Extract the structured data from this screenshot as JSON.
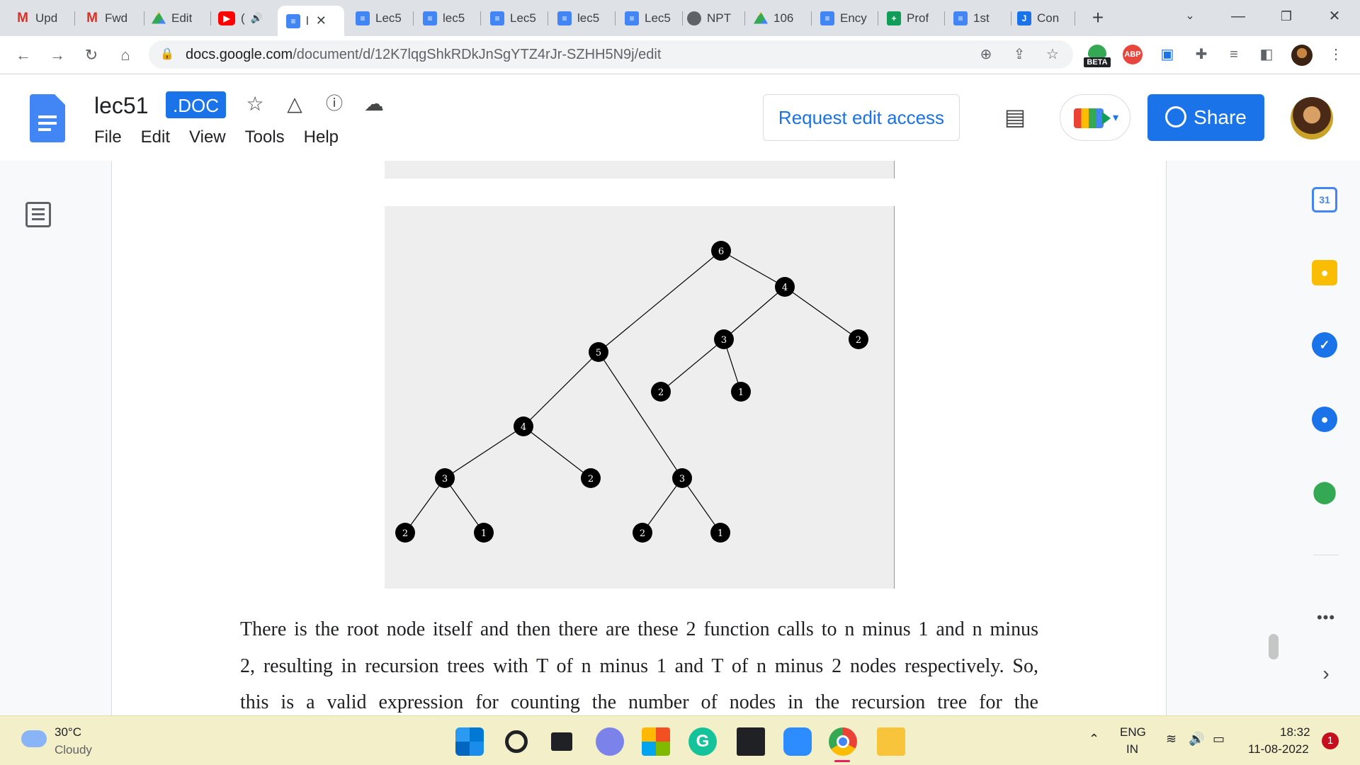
{
  "browser": {
    "tabs": [
      {
        "label": "Upd",
        "icon": "gmail-icon"
      },
      {
        "label": "Fwd",
        "icon": "gmail-icon"
      },
      {
        "label": "Edit",
        "icon": "drive-icon"
      },
      {
        "label": "(",
        "icon": "youtube-icon"
      },
      {
        "label": "l",
        "icon": "docs-icon",
        "active": true
      },
      {
        "label": "Lec5",
        "icon": "docs-icon"
      },
      {
        "label": "lec5",
        "icon": "docs-icon"
      },
      {
        "label": "Lec5",
        "icon": "docs-icon"
      },
      {
        "label": "lec5",
        "icon": "docs-icon"
      },
      {
        "label": "Lec5",
        "icon": "docs-icon"
      },
      {
        "label": "NPT",
        "icon": "globe-icon"
      },
      {
        "label": "106",
        "icon": "drive-icon"
      },
      {
        "label": "Ency",
        "icon": "docs-icon"
      },
      {
        "label": "Prof",
        "icon": "sheets-icon"
      },
      {
        "label": "1st",
        "icon": "docs-icon"
      },
      {
        "label": "Con",
        "icon": "jamboard-icon"
      }
    ],
    "url_host": "docs.google.com",
    "url_path": "/document/d/12K7lqgShkRDkJnSgYTZ4rJr-SZHH5N9j/edit",
    "beta_label": "BETA",
    "abp_label": "ABP"
  },
  "docs": {
    "title": "lec51",
    "badge": ".DOC",
    "menu": [
      "File",
      "Edit",
      "View",
      "Tools",
      "Help"
    ],
    "request_edit_label": "Request edit access",
    "share_label": "Share",
    "calendar_day": "31"
  },
  "figure": {
    "node_fill": "#000000",
    "label_color": "#ffffff",
    "edge_color": "#000000",
    "nodes": [
      {
        "id": "a",
        "label": "6"
      },
      {
        "id": "b",
        "label": "4"
      },
      {
        "id": "c",
        "label": "3"
      },
      {
        "id": "d",
        "label": "2"
      },
      {
        "id": "e",
        "label": "5"
      },
      {
        "id": "f",
        "label": "2"
      },
      {
        "id": "g",
        "label": "1"
      },
      {
        "id": "h",
        "label": "4"
      },
      {
        "id": "i",
        "label": "3"
      },
      {
        "id": "j",
        "label": "2"
      },
      {
        "id": "k",
        "label": "3"
      },
      {
        "id": "l",
        "label": "2"
      },
      {
        "id": "m",
        "label": "1"
      },
      {
        "id": "n",
        "label": "2"
      },
      {
        "id": "o",
        "label": "1"
      }
    ],
    "edges": [
      [
        "a",
        "b"
      ],
      [
        "a",
        "e"
      ],
      [
        "b",
        "c"
      ],
      [
        "b",
        "d"
      ],
      [
        "c",
        "f"
      ],
      [
        "c",
        "g"
      ],
      [
        "e",
        "h"
      ],
      [
        "e",
        "k"
      ],
      [
        "h",
        "i"
      ],
      [
        "h",
        "j"
      ],
      [
        "i",
        "l"
      ],
      [
        "i",
        "m"
      ],
      [
        "k",
        "n"
      ],
      [
        "k",
        "o"
      ]
    ]
  },
  "paragraph": {
    "lines": [
      "There is the root node itself and then there are these 2 function calls to n minus 1 and n minus",
      "2, resulting in recursion trees with T of n minus 1 and T of n minus 2 nodes respectively. So,",
      "this is a valid expression for counting the number of nodes in the recursion tree for the"
    ]
  },
  "taskbar": {
    "temperature": "30°C",
    "weather": "Cloudy",
    "lang_top": "ENG",
    "lang_bottom": "IN",
    "time": "18:32",
    "date": "11-08-2022",
    "notifications": "1"
  }
}
